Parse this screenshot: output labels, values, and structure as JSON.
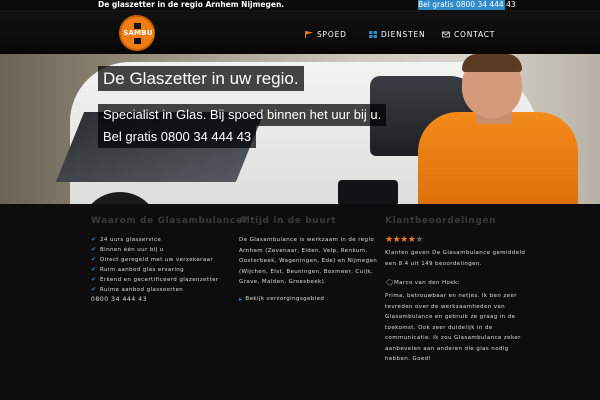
{
  "topbar": {
    "tagline": "De glaszetter in de regio Arnhem Nijmegen.",
    "phone": "Bel gratis 0800 34 444 43"
  },
  "logo": {
    "text": "SAMBU",
    "icon": "ambulance-cross-logo"
  },
  "nav": [
    {
      "label": "SPOED",
      "icon": "flag-icon",
      "color": "#f07c14"
    },
    {
      "label": "DIENSTEN",
      "icon": "windows-icon",
      "color": "#2e8ac8"
    },
    {
      "label": "CONTACT",
      "icon": "mail-icon",
      "color": "#cccccc"
    }
  ],
  "hero": {
    "headline": "De Glaszetter in uw regio.",
    "line2": "Specialist in Glas. Bij spoed binnen het uur bij u.",
    "line3": "Bel gratis 0800 34 444 43"
  },
  "why": {
    "title": "Waarom de Glasambulance?",
    "items": [
      "24 uurs glasservice",
      "Binnen één uur bij u",
      "Direct geregeld met uw verzekeraar",
      "Ruim aanbod glas ervaring",
      "Erkend en gecertificeerd glazenzetter",
      "Ruime aanbod glassoorten"
    ],
    "phone": "0800 34 444 43"
  },
  "area": {
    "title": "Altijd in de buurt",
    "text": "De Glasambulance is werkzaam in de regio Arnhem (Zevenaar, Elden, Velp, Renkum, Oosterbeek, Wageningen, Ede) en Nijmegen (Wijchen, Elst, Beuningen, Boxmeer, Cuijk, Grave, Malden, Groesbeek).",
    "link": "Bekijk verzorgingsgebied"
  },
  "reviews": {
    "title": "Klantbeoordelingen",
    "rating": 4,
    "max": 5,
    "summary": "Klanten geven De Glasambulance gemiddeld een 8.4 uit 149 beoordelingen.",
    "quote_author": "Marco van den Hoek:",
    "quote": "Prima, betrouwbaar en netjes. Ik ben zeer tevreden over de werkzaamheden van Glasambulance en gebruik ze graag in de toekomst. Ook zeer duidelijk in de communicatie. Ik zou Glasambulance zeker aanbevelen aan anderen die glas nodig hebben. Goed!"
  },
  "colors": {
    "accent": "#2e8ac8",
    "brand": "#f07c14",
    "background": "#0d0d0d"
  }
}
